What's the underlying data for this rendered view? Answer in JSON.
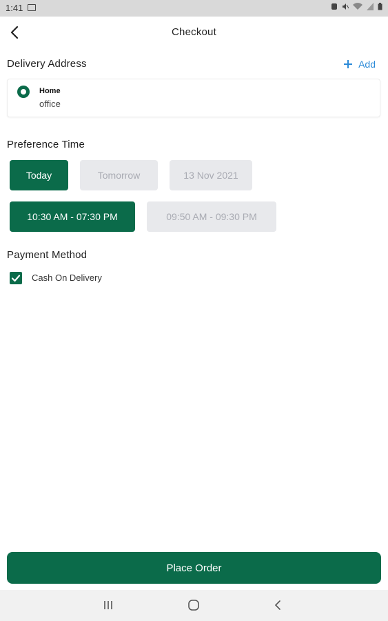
{
  "status_bar": {
    "time": "1:41",
    "icons": [
      "image-icon",
      "alarm-icon",
      "mute-icon",
      "wifi-icon",
      "signal-icon",
      "battery-icon"
    ]
  },
  "header": {
    "title": "Checkout",
    "back_icon": "back-chevron-icon"
  },
  "delivery": {
    "section_title": "Delivery Address",
    "add_label": "Add",
    "addresses": [
      {
        "name": "Home",
        "detail": "office",
        "selected": true
      }
    ]
  },
  "preference": {
    "section_title": "Preference Time",
    "days": [
      {
        "label": "Today",
        "selected": true
      },
      {
        "label": "Tomorrow",
        "selected": false
      },
      {
        "label": "13 Nov 2021",
        "selected": false
      }
    ],
    "slots": [
      {
        "label": "10:30 AM - 07:30 PM",
        "selected": true
      },
      {
        "label": "09:50 AM - 09:30 PM",
        "selected": false
      }
    ]
  },
  "payment": {
    "section_title": "Payment Method",
    "method_label": "Cash On Delivery",
    "checked": true
  },
  "actions": {
    "place_order_label": "Place Order"
  },
  "colors": {
    "primary": "#0b6b4a",
    "accent": "#2b8ad8",
    "chip_inactive_bg": "#e8e9ec",
    "chip_inactive_text": "#a9abb3"
  }
}
